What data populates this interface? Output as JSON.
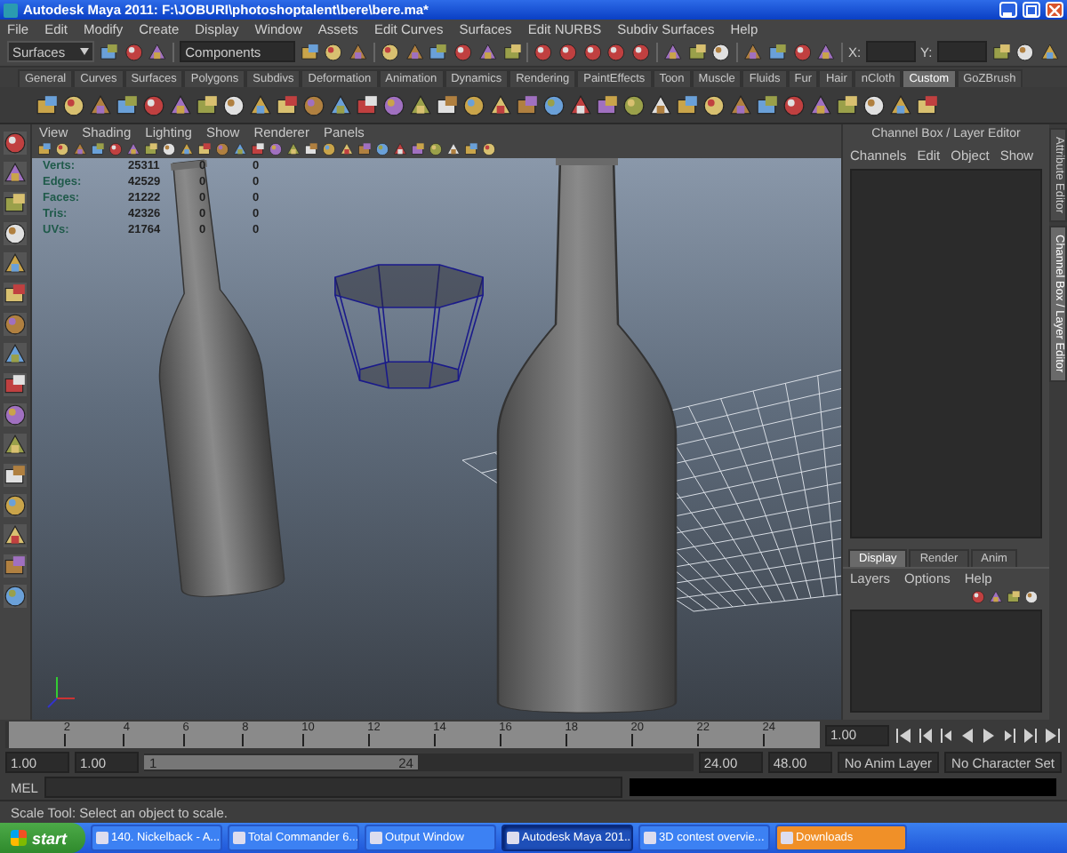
{
  "window": {
    "title": "Autodesk Maya 2011: F:\\JOBURI\\photoshoptalent\\bere\\bere.ma*"
  },
  "menu": [
    "File",
    "Edit",
    "Modify",
    "Create",
    "Display",
    "Window",
    "Assets",
    "Edit Curves",
    "Surfaces",
    "Edit NURBS",
    "Subdiv Surfaces",
    "Help"
  ],
  "status_line": {
    "mode": "Surfaces",
    "selection_field": "Components",
    "x_label": "X:",
    "y_label": "Y:"
  },
  "shelf_tabs": [
    {
      "label": "General",
      "selected": false
    },
    {
      "label": "Curves",
      "selected": false
    },
    {
      "label": "Surfaces",
      "selected": false
    },
    {
      "label": "Polygons",
      "selected": false
    },
    {
      "label": "Subdivs",
      "selected": false
    },
    {
      "label": "Deformation",
      "selected": false
    },
    {
      "label": "Animation",
      "selected": false
    },
    {
      "label": "Dynamics",
      "selected": false
    },
    {
      "label": "Rendering",
      "selected": false
    },
    {
      "label": "PaintEffects",
      "selected": false
    },
    {
      "label": "Toon",
      "selected": false
    },
    {
      "label": "Muscle",
      "selected": false
    },
    {
      "label": "Fluids",
      "selected": false
    },
    {
      "label": "Fur",
      "selected": false
    },
    {
      "label": "Hair",
      "selected": false
    },
    {
      "label": "nCloth",
      "selected": false
    },
    {
      "label": "Custom",
      "selected": true
    },
    {
      "label": "GoZBrush",
      "selected": false
    }
  ],
  "panel_menu": [
    "View",
    "Shading",
    "Lighting",
    "Show",
    "Renderer",
    "Panels"
  ],
  "hud": [
    {
      "label": "Verts:",
      "values": [
        "25311",
        "0",
        "0"
      ]
    },
    {
      "label": "Edges:",
      "values": [
        "42529",
        "0",
        "0"
      ]
    },
    {
      "label": "Faces:",
      "values": [
        "21222",
        "0",
        "0"
      ]
    },
    {
      "label": "Tris:",
      "values": [
        "42326",
        "0",
        "0"
      ]
    },
    {
      "label": "UVs:",
      "values": [
        "21764",
        "0",
        "0"
      ]
    }
  ],
  "channel_box": {
    "title": "Channel Box / Layer Editor",
    "menu": [
      "Channels",
      "Edit",
      "Object",
      "Show"
    ]
  },
  "side_tabs": [
    {
      "label": "Attribute Editor",
      "selected": false
    },
    {
      "label": "Channel Box / Layer Editor",
      "selected": true
    }
  ],
  "layer_editor": {
    "tabs": [
      {
        "label": "Display",
        "selected": true
      },
      {
        "label": "Render",
        "selected": false
      },
      {
        "label": "Anim",
        "selected": false
      }
    ],
    "menu": [
      "Layers",
      "Options",
      "Help"
    ]
  },
  "timeline": {
    "level": 0,
    "ticks": [
      "2",
      "4",
      "6",
      "8",
      "10",
      "12",
      "14",
      "16",
      "18",
      "20",
      "22",
      "24"
    ],
    "current_time": "1.00"
  },
  "range": {
    "level": 0.5,
    "start": "1.00",
    "playback_start": "1.00",
    "slider_start": "1",
    "slider_end": "24",
    "playback_end": "24.00",
    "end": "48.00",
    "anim_layer": "No Anim Layer",
    "character_set": "No Character Set"
  },
  "command_line": {
    "label": "MEL"
  },
  "help_line": "Scale Tool: Select an object to scale.",
  "taskbar": {
    "start": "start",
    "tasks": [
      {
        "label": "140. Nickelback - A...",
        "selected": false,
        "flashing": false
      },
      {
        "label": "Total Commander 6...",
        "selected": false,
        "flashing": false
      },
      {
        "label": "Output Window",
        "selected": false,
        "flashing": false
      },
      {
        "label": "Autodesk Maya 201...",
        "selected": true,
        "flashing": false
      },
      {
        "label": "3D contest overvie...",
        "selected": false,
        "flashing": false
      },
      {
        "label": "Downloads",
        "selected": false,
        "flashing": true
      }
    ]
  }
}
